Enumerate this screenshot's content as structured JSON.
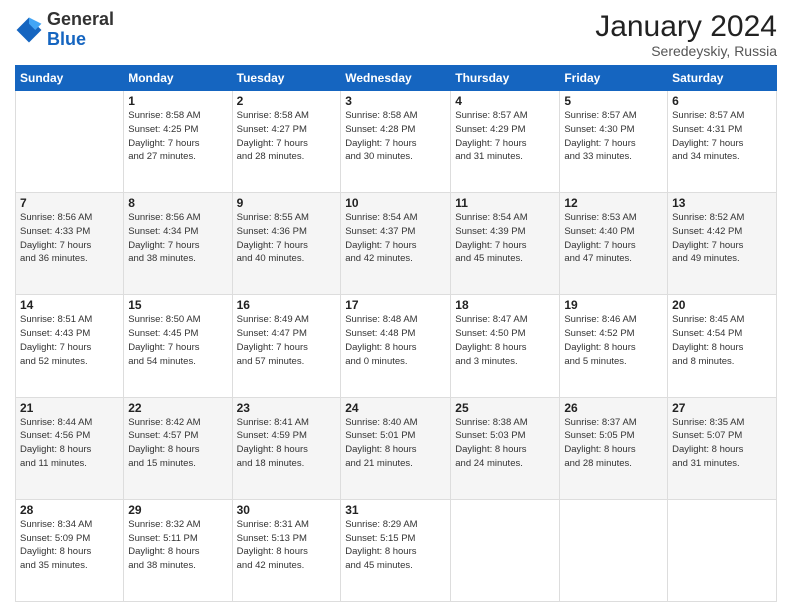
{
  "header": {
    "logo_general": "General",
    "logo_blue": "Blue",
    "month_title": "January 2024",
    "location": "Seredeyskiy, Russia"
  },
  "weekdays": [
    "Sunday",
    "Monday",
    "Tuesday",
    "Wednesday",
    "Thursday",
    "Friday",
    "Saturday"
  ],
  "weeks": [
    [
      {
        "day": "",
        "info": ""
      },
      {
        "day": "1",
        "info": "Sunrise: 8:58 AM\nSunset: 4:25 PM\nDaylight: 7 hours\nand 27 minutes."
      },
      {
        "day": "2",
        "info": "Sunrise: 8:58 AM\nSunset: 4:27 PM\nDaylight: 7 hours\nand 28 minutes."
      },
      {
        "day": "3",
        "info": "Sunrise: 8:58 AM\nSunset: 4:28 PM\nDaylight: 7 hours\nand 30 minutes."
      },
      {
        "day": "4",
        "info": "Sunrise: 8:57 AM\nSunset: 4:29 PM\nDaylight: 7 hours\nand 31 minutes."
      },
      {
        "day": "5",
        "info": "Sunrise: 8:57 AM\nSunset: 4:30 PM\nDaylight: 7 hours\nand 33 minutes."
      },
      {
        "day": "6",
        "info": "Sunrise: 8:57 AM\nSunset: 4:31 PM\nDaylight: 7 hours\nand 34 minutes."
      }
    ],
    [
      {
        "day": "7",
        "info": "Sunrise: 8:56 AM\nSunset: 4:33 PM\nDaylight: 7 hours\nand 36 minutes."
      },
      {
        "day": "8",
        "info": "Sunrise: 8:56 AM\nSunset: 4:34 PM\nDaylight: 7 hours\nand 38 minutes."
      },
      {
        "day": "9",
        "info": "Sunrise: 8:55 AM\nSunset: 4:36 PM\nDaylight: 7 hours\nand 40 minutes."
      },
      {
        "day": "10",
        "info": "Sunrise: 8:54 AM\nSunset: 4:37 PM\nDaylight: 7 hours\nand 42 minutes."
      },
      {
        "day": "11",
        "info": "Sunrise: 8:54 AM\nSunset: 4:39 PM\nDaylight: 7 hours\nand 45 minutes."
      },
      {
        "day": "12",
        "info": "Sunrise: 8:53 AM\nSunset: 4:40 PM\nDaylight: 7 hours\nand 47 minutes."
      },
      {
        "day": "13",
        "info": "Sunrise: 8:52 AM\nSunset: 4:42 PM\nDaylight: 7 hours\nand 49 minutes."
      }
    ],
    [
      {
        "day": "14",
        "info": "Sunrise: 8:51 AM\nSunset: 4:43 PM\nDaylight: 7 hours\nand 52 minutes."
      },
      {
        "day": "15",
        "info": "Sunrise: 8:50 AM\nSunset: 4:45 PM\nDaylight: 7 hours\nand 54 minutes."
      },
      {
        "day": "16",
        "info": "Sunrise: 8:49 AM\nSunset: 4:47 PM\nDaylight: 7 hours\nand 57 minutes."
      },
      {
        "day": "17",
        "info": "Sunrise: 8:48 AM\nSunset: 4:48 PM\nDaylight: 8 hours\nand 0 minutes."
      },
      {
        "day": "18",
        "info": "Sunrise: 8:47 AM\nSunset: 4:50 PM\nDaylight: 8 hours\nand 3 minutes."
      },
      {
        "day": "19",
        "info": "Sunrise: 8:46 AM\nSunset: 4:52 PM\nDaylight: 8 hours\nand 5 minutes."
      },
      {
        "day": "20",
        "info": "Sunrise: 8:45 AM\nSunset: 4:54 PM\nDaylight: 8 hours\nand 8 minutes."
      }
    ],
    [
      {
        "day": "21",
        "info": "Sunrise: 8:44 AM\nSunset: 4:56 PM\nDaylight: 8 hours\nand 11 minutes."
      },
      {
        "day": "22",
        "info": "Sunrise: 8:42 AM\nSunset: 4:57 PM\nDaylight: 8 hours\nand 15 minutes."
      },
      {
        "day": "23",
        "info": "Sunrise: 8:41 AM\nSunset: 4:59 PM\nDaylight: 8 hours\nand 18 minutes."
      },
      {
        "day": "24",
        "info": "Sunrise: 8:40 AM\nSunset: 5:01 PM\nDaylight: 8 hours\nand 21 minutes."
      },
      {
        "day": "25",
        "info": "Sunrise: 8:38 AM\nSunset: 5:03 PM\nDaylight: 8 hours\nand 24 minutes."
      },
      {
        "day": "26",
        "info": "Sunrise: 8:37 AM\nSunset: 5:05 PM\nDaylight: 8 hours\nand 28 minutes."
      },
      {
        "day": "27",
        "info": "Sunrise: 8:35 AM\nSunset: 5:07 PM\nDaylight: 8 hours\nand 31 minutes."
      }
    ],
    [
      {
        "day": "28",
        "info": "Sunrise: 8:34 AM\nSunset: 5:09 PM\nDaylight: 8 hours\nand 35 minutes."
      },
      {
        "day": "29",
        "info": "Sunrise: 8:32 AM\nSunset: 5:11 PM\nDaylight: 8 hours\nand 38 minutes."
      },
      {
        "day": "30",
        "info": "Sunrise: 8:31 AM\nSunset: 5:13 PM\nDaylight: 8 hours\nand 42 minutes."
      },
      {
        "day": "31",
        "info": "Sunrise: 8:29 AM\nSunset: 5:15 PM\nDaylight: 8 hours\nand 45 minutes."
      },
      {
        "day": "",
        "info": ""
      },
      {
        "day": "",
        "info": ""
      },
      {
        "day": "",
        "info": ""
      }
    ]
  ]
}
